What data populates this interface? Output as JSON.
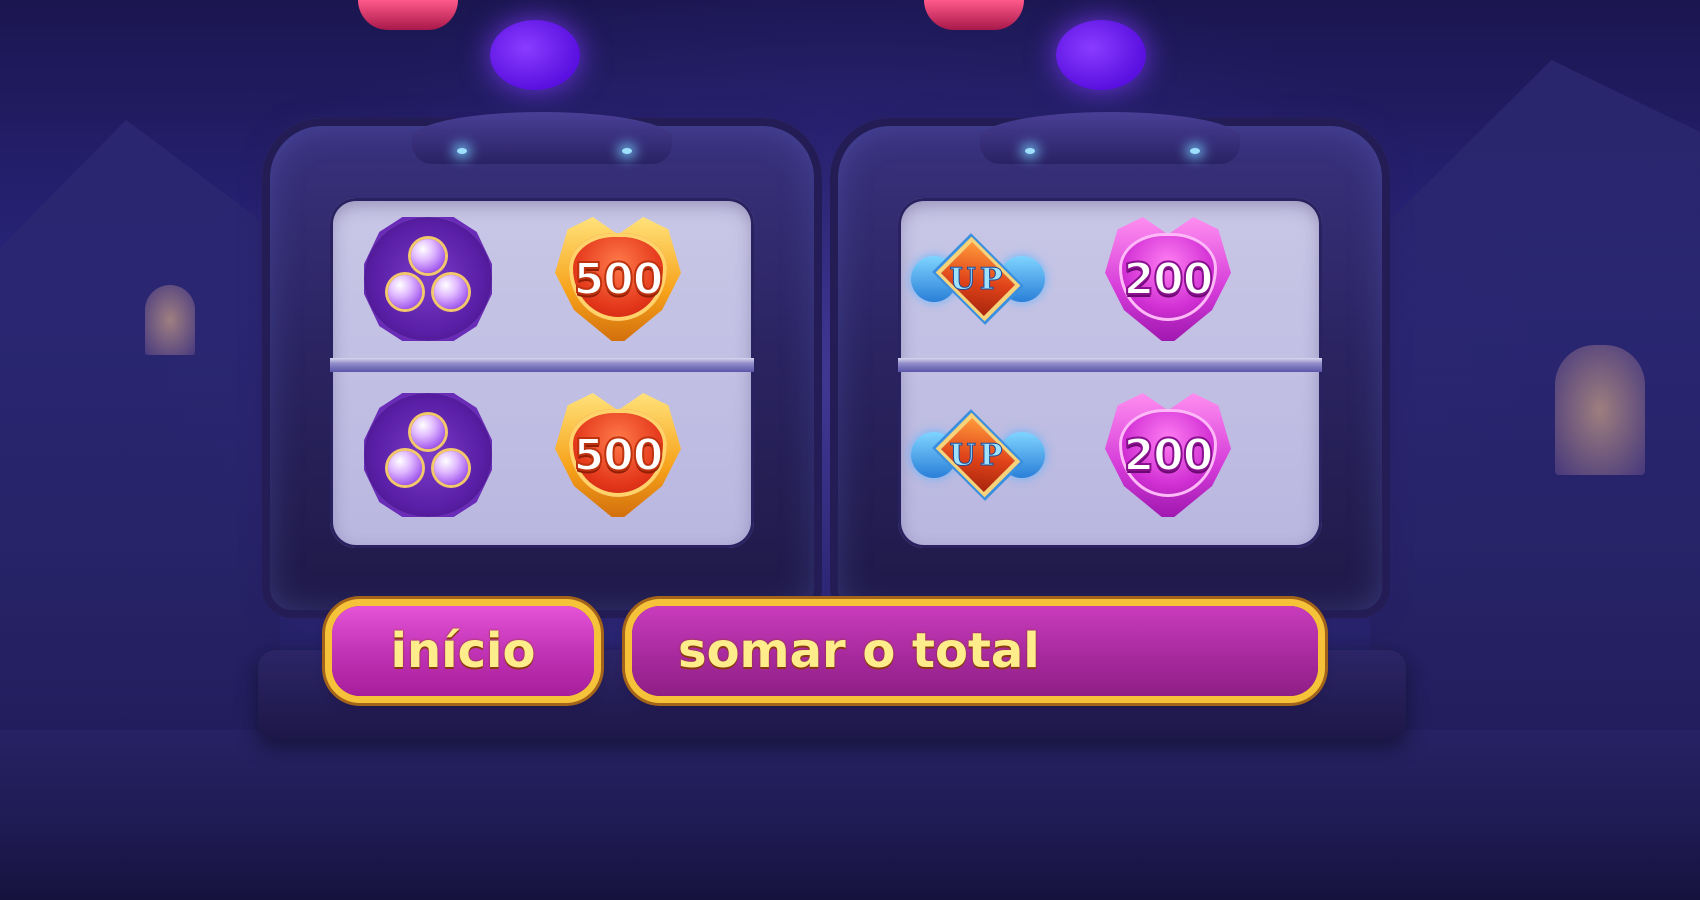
{
  "game": {
    "reels": [
      {
        "rows": [
          [
            {
              "symbol": "club-gem-icon"
            },
            {
              "symbol": "winged-badge-gold",
              "value": "500"
            }
          ],
          [
            {
              "symbol": "club-gem-icon"
            },
            {
              "symbol": "winged-badge-gold",
              "value": "500"
            }
          ]
        ]
      },
      {
        "rows": [
          [
            {
              "symbol": "up-emblem",
              "value": "UP"
            },
            {
              "symbol": "winged-badge-pink",
              "value": "200"
            }
          ],
          [
            {
              "symbol": "up-emblem",
              "value": "UP"
            },
            {
              "symbol": "winged-badge-pink",
              "value": "200"
            }
          ]
        ]
      }
    ],
    "buttons": {
      "start_label": "início",
      "sum_label": "somar o total"
    },
    "colors": {
      "button_fill": "#c234b6",
      "button_border": "#f5c23a",
      "button_text": "#ffec8a",
      "window_bg": "#c9c7e6"
    }
  }
}
